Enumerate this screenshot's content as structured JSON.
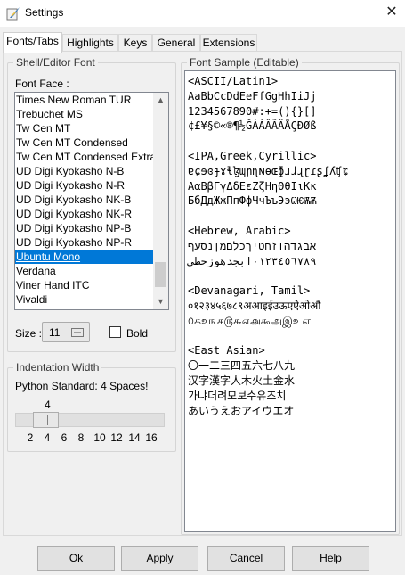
{
  "window": {
    "title": "Settings",
    "close_glyph": "✕"
  },
  "tabs": [
    {
      "label": "Fonts/Tabs",
      "active": true
    },
    {
      "label": "Highlights",
      "active": false
    },
    {
      "label": "Keys",
      "active": false
    },
    {
      "label": "General",
      "active": false
    },
    {
      "label": "Extensions",
      "active": false
    }
  ],
  "shell_font": {
    "group_label": "Shell/Editor Font",
    "font_face_label": "Font Face :",
    "fonts": [
      "Times New Roman TUR",
      "Trebuchet MS",
      "Tw Cen MT",
      "Tw Cen MT Condensed",
      "Tw Cen MT Condensed Extra",
      "UD Digi Kyokasho N-B",
      "UD Digi Kyokasho N-R",
      "UD Digi Kyokasho NK-B",
      "UD Digi Kyokasho NK-R",
      "UD Digi Kyokasho NP-B",
      "UD Digi Kyokasho NP-R",
      "Ubuntu Mono",
      "Verdana",
      "Viner Hand ITC",
      "Vivaldi"
    ],
    "selected_font": "Ubuntu Mono",
    "size_label": "Size :",
    "size_value": "11",
    "bold_label": "Bold",
    "bold_checked": false
  },
  "indentation": {
    "group_label": "Indentation Width",
    "python_standard": "Python Standard: 4 Spaces!",
    "value": "4",
    "slider_value": 4,
    "ticks": [
      "2",
      "4",
      "6",
      "8",
      "10",
      "12",
      "14",
      "16"
    ]
  },
  "font_sample": {
    "group_label": "Font Sample (Editable)",
    "lines": [
      "<ASCII/Latin1>",
      "AaBbCcDdEeFfGgHhIiJj",
      "1234567890#:+=(){}[]",
      "¢£¥§©«®¶½ĞÀÁÂÃÄÅÇÐØß",
      "",
      "<IPA,Greek,Cyrillic>",
      "ɐɕɘɞɟɤɬɮɰɲɳɴɵɶɸɹɺɻɽɾʂʆʎʧʨ",
      "ΑαΒβΓγΔδΕεΖζΗηΘθΙιΚκ",
      "БбДдЖжПпФфЧчЪъЭэѠѤѬѪ",
      "",
      "<Hebrew, Arabic>",
      "אבגדהוזחטיךכלםמןנסעף",
      "٠١٢٣٤٥٦٧٨٩ابجدهوزحطي",
      "",
      "<Devanagari, Tamil>",
      "०१२३४५६७८९अआइईउऊएऐओऔ",
      "௦௧௨௩௪௫௬௭௮௯அஇஉஎ",
      "",
      "<East Asian>",
      "〇一二三四五六七八九",
      "汉字漢字人木火土金水",
      "가냐더려모보수유즈치",
      "あいうえおアイウエオ"
    ]
  },
  "buttons": {
    "ok": "Ok",
    "apply": "Apply",
    "cancel": "Cancel",
    "help": "Help"
  }
}
